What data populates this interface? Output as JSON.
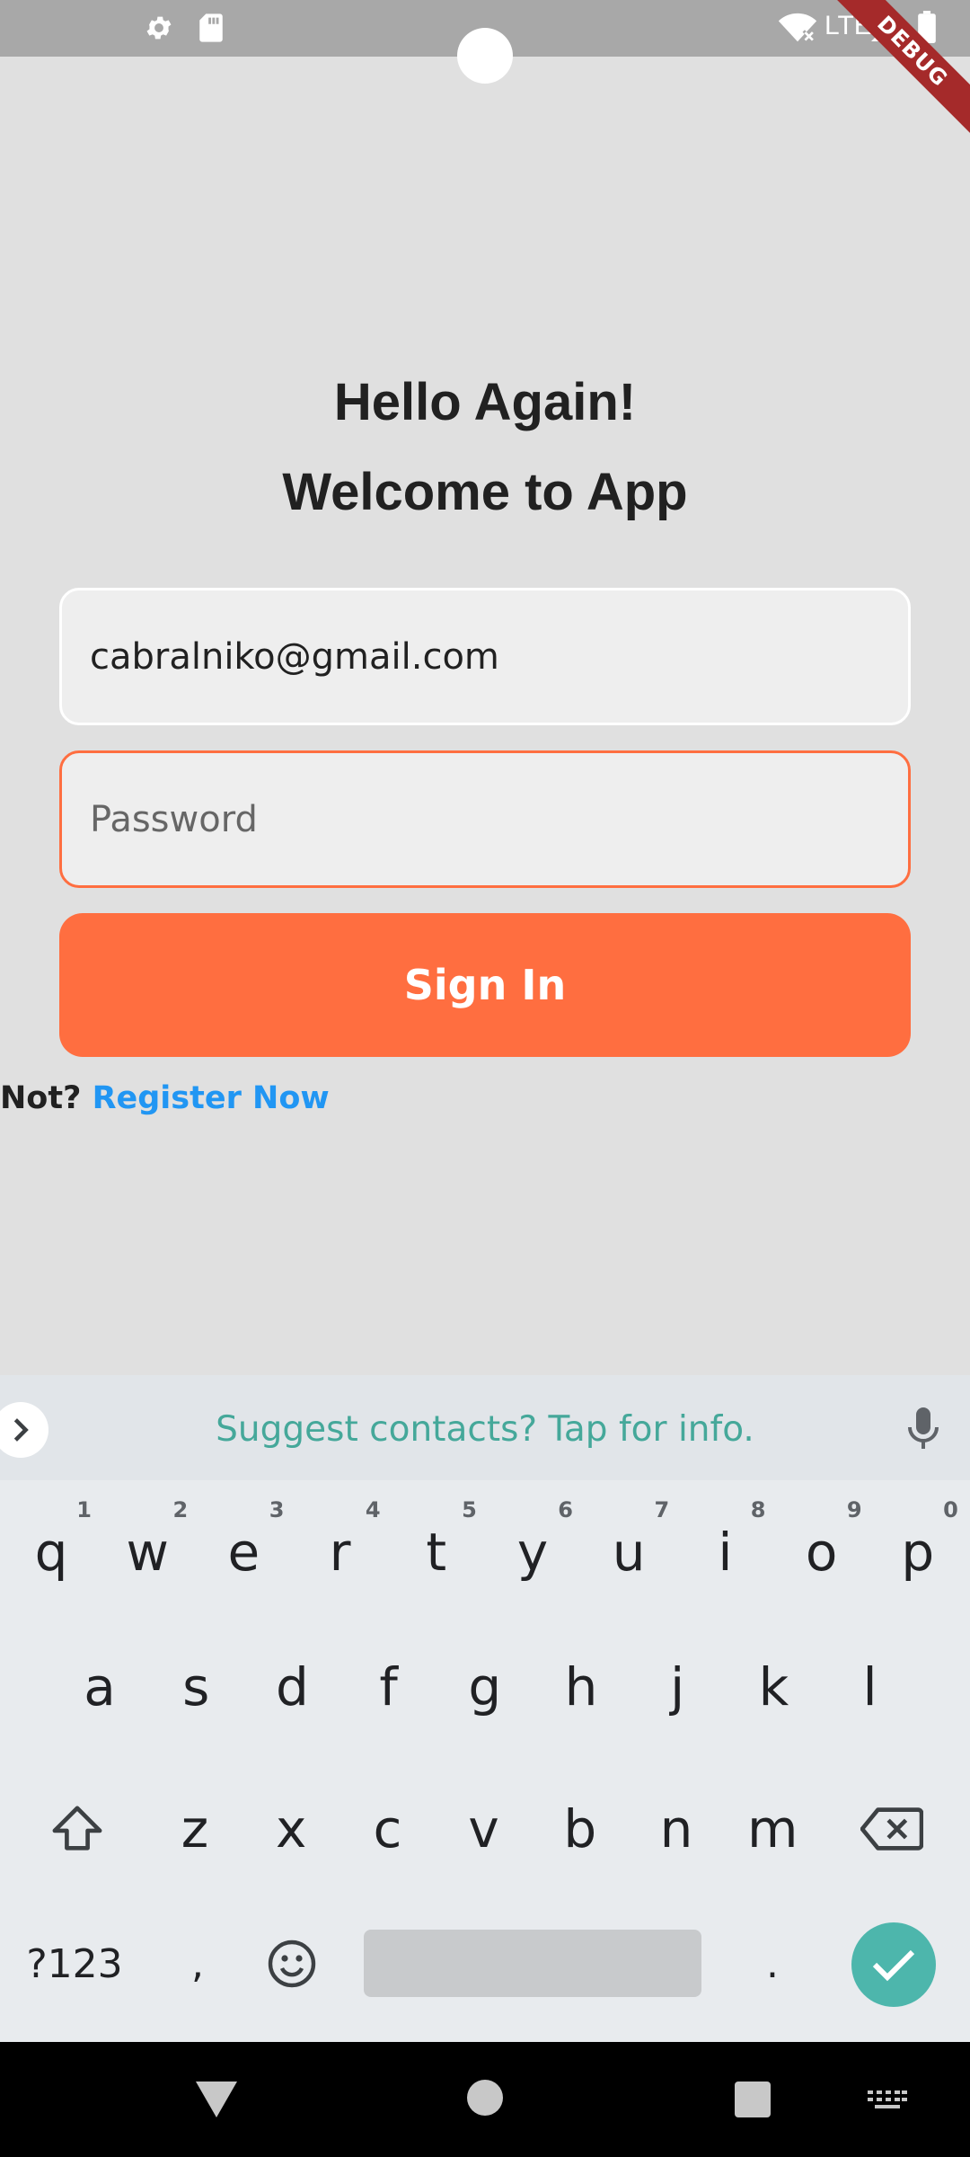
{
  "status_bar": {
    "network": "LTE",
    "debug_banner": "DEBUG"
  },
  "login": {
    "title_line1": "Hello Again!",
    "title_line2": "Welcome to App",
    "email_value": "cabralniko@gmail.com",
    "password_placeholder": "Password",
    "sign_in_label": "Sign In",
    "register_prompt": "Not?",
    "register_link": "Register Now"
  },
  "keyboard": {
    "suggestion": "Suggest contacts? Tap for info.",
    "row1": [
      {
        "key": "q",
        "hint": "1"
      },
      {
        "key": "w",
        "hint": "2"
      },
      {
        "key": "e",
        "hint": "3"
      },
      {
        "key": "r",
        "hint": "4"
      },
      {
        "key": "t",
        "hint": "5"
      },
      {
        "key": "y",
        "hint": "6"
      },
      {
        "key": "u",
        "hint": "7"
      },
      {
        "key": "i",
        "hint": "8"
      },
      {
        "key": "o",
        "hint": "9"
      },
      {
        "key": "p",
        "hint": "0"
      }
    ],
    "row2": [
      "a",
      "s",
      "d",
      "f",
      "g",
      "h",
      "j",
      "k",
      "l"
    ],
    "row3": [
      "z",
      "x",
      "c",
      "v",
      "b",
      "n",
      "m"
    ],
    "symbols_label": "?123",
    "comma": ",",
    "period": "."
  },
  "colors": {
    "accent": "#ff6e40",
    "link": "#2196f3",
    "background": "#e0e0e0",
    "keyboard_teal": "#4db6ac"
  }
}
